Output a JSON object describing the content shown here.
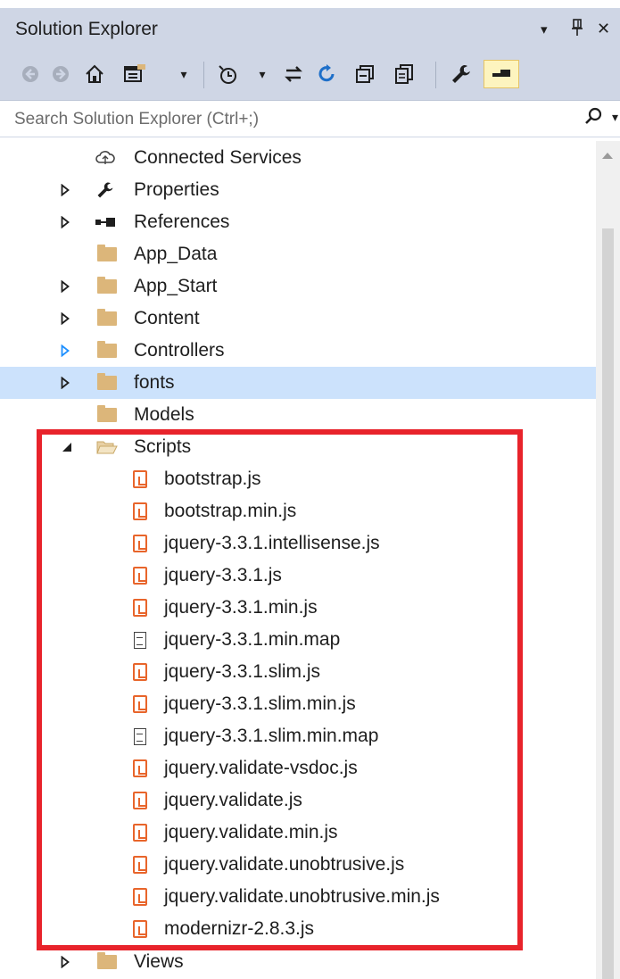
{
  "window": {
    "title": "Solution Explorer",
    "controls": {
      "dropdown": "▾",
      "pin": "ᚹ",
      "close": "✕"
    }
  },
  "toolbar": {
    "back": "◀",
    "forward": "▶",
    "home": "⌂",
    "switch_views": "▤",
    "dropdown": "▾",
    "pending_changes": "◔",
    "pending_dropdown": "▾",
    "sync": "⇆",
    "refresh": "↻",
    "collapse_all": "⊟",
    "show_all_files": "⧉",
    "properties": "🔧",
    "preview": "▬"
  },
  "search": {
    "placeholder": "Search Solution Explorer (Ctrl+;)",
    "icon": "⚲",
    "dropdown": "▾"
  },
  "tree": [
    {
      "label": "Connected Services",
      "icon": "cloud-icon",
      "expander": ""
    },
    {
      "label": "Properties",
      "icon": "wrench-icon",
      "expander": "▷"
    },
    {
      "label": "References",
      "icon": "references-icon",
      "expander": "▷"
    },
    {
      "label": "App_Data",
      "icon": "folder-icon",
      "expander": ""
    },
    {
      "label": "App_Start",
      "icon": "folder-icon",
      "expander": "▷"
    },
    {
      "label": "Content",
      "icon": "folder-icon",
      "expander": "▷"
    },
    {
      "label": "Controllers",
      "icon": "folder-icon",
      "expander": "▷"
    },
    {
      "label": "fonts",
      "icon": "folder-icon",
      "expander": "▷",
      "selected": true
    },
    {
      "label": "Models",
      "icon": "folder-icon",
      "expander": ""
    },
    {
      "label": "Scripts",
      "icon": "folder-open-icon",
      "expander": "◢"
    },
    {
      "label": "bootstrap.js",
      "icon": "js-file-icon"
    },
    {
      "label": "bootstrap.min.js",
      "icon": "js-file-icon"
    },
    {
      "label": "jquery-3.3.1.intellisense.js",
      "icon": "js-file-icon"
    },
    {
      "label": "jquery-3.3.1.js",
      "icon": "js-file-icon"
    },
    {
      "label": "jquery-3.3.1.min.js",
      "icon": "js-file-icon"
    },
    {
      "label": "jquery-3.3.1.min.map",
      "icon": "document-icon"
    },
    {
      "label": "jquery-3.3.1.slim.js",
      "icon": "js-file-icon"
    },
    {
      "label": "jquery-3.3.1.slim.min.js",
      "icon": "js-file-icon"
    },
    {
      "label": "jquery-3.3.1.slim.min.map",
      "icon": "document-icon"
    },
    {
      "label": "jquery.validate-vsdoc.js",
      "icon": "js-file-icon"
    },
    {
      "label": "jquery.validate.js",
      "icon": "js-file-icon"
    },
    {
      "label": "jquery.validate.min.js",
      "icon": "js-file-icon"
    },
    {
      "label": "jquery.validate.unobtrusive.js",
      "icon": "js-file-icon"
    },
    {
      "label": "jquery.validate.unobtrusive.min.js",
      "icon": "js-file-icon"
    },
    {
      "label": "modernizr-2.8.3.js",
      "icon": "js-file-icon"
    },
    {
      "label": "Views",
      "icon": "folder-icon",
      "expander": "▷"
    }
  ],
  "colors": {
    "titlebar": "#cfd6e5",
    "selection": "#cce2fc",
    "highlight_box": "#e8232b",
    "js_icon": "#e8652b",
    "folder": "#dcb67a",
    "controllers_expander": "#1e90ff"
  }
}
